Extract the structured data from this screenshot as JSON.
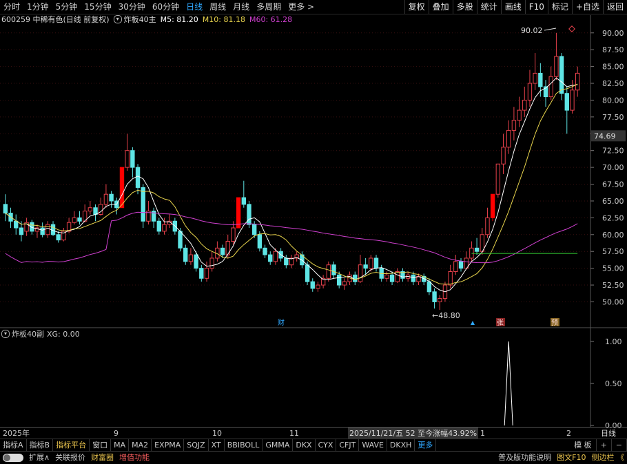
{
  "toolbar": {
    "timeframes": [
      "分时",
      "1分钟",
      "5分钟",
      "15分钟",
      "30分钟",
      "60分钟",
      "日线",
      "周线",
      "月线",
      "多周期",
      "更多 >"
    ],
    "active_index": 6,
    "right_buttons": [
      "复权",
      "叠加",
      "多股",
      "统计",
      "画线",
      "F10",
      "标记",
      "+自选",
      "返回"
    ]
  },
  "info": {
    "stock": "600259 中稀有色(日线 前复权)",
    "indicator": "炸板40主",
    "m5": "M5: 81.20",
    "m10": "M10: 81.18",
    "m60": "M60: 61.28",
    "colors": {
      "m5": "#ffffff",
      "m10": "#e8d44d",
      "m60": "#d040d0",
      "up": "#e8414b",
      "down": "#5ee5e5",
      "limit": "#ff0000"
    }
  },
  "price_axis": [
    "90.00",
    "87.50",
    "85.00",
    "82.50",
    "80.00",
    "77.50",
    "75.00",
    "72.50",
    "70.00",
    "67.50",
    "65.00",
    "62.50",
    "60.00",
    "57.50",
    "55.00",
    "52.50",
    "50.00"
  ],
  "current_price": "74.69",
  "annotations": {
    "high": "90.02",
    "low": "48.80",
    "marks": [
      "财",
      "张",
      "预"
    ]
  },
  "sub": {
    "title": "炸板40副",
    "xg": "XG: 0.00",
    "axis": [
      "1.00",
      "0.50",
      "0.00"
    ]
  },
  "datebar": {
    "year": "2025年",
    "months": [
      "9",
      "10",
      "11",
      "1",
      "2"
    ],
    "cursor_info": "2025/11/21/五 52 至今涨幅43.92%",
    "period": "日线"
  },
  "indicators": [
    "指标A",
    "指标B",
    "指标平台",
    "窗口",
    "MA",
    "MA2",
    "EXPMA",
    "SQJZ",
    "XT",
    "BBIBOLL",
    "GMMA",
    "DKX",
    "CYX",
    "CFJT",
    "WAVE",
    "DKXH",
    "更多"
  ],
  "indicator_right": [
    "模 板",
    "+",
    "−"
  ],
  "bottom": {
    "left": [
      "扩展∧",
      "关联报价",
      "财富圈",
      "增值功能"
    ],
    "right": [
      "普及版功能说明",
      "图文F10",
      "侧边栏 《"
    ]
  },
  "chart_data": {
    "type": "candlestick",
    "ylim": [
      48.0,
      91.0
    ],
    "candles": [
      [
        64.5,
        63.2,
        66.0,
        62.0
      ],
      [
        63.2,
        62.0,
        64.0,
        61.0
      ],
      [
        62.0,
        61.0,
        63.0,
        60.0
      ],
      [
        61.0,
        60.0,
        62.0,
        59.0
      ],
      [
        60.5,
        61.8,
        62.5,
        59.8
      ],
      [
        61.8,
        60.5,
        62.2,
        60.0
      ],
      [
        60.5,
        61.0,
        61.5,
        59.5
      ],
      [
        61.0,
        60.0,
        61.8,
        59.6
      ],
      [
        60.0,
        61.5,
        62.0,
        59.5
      ],
      [
        61.5,
        60.0,
        62.0,
        59.8
      ],
      [
        60.0,
        59.2,
        60.5,
        58.8
      ],
      [
        59.2,
        60.5,
        61.0,
        59.0
      ],
      [
        60.5,
        61.8,
        62.5,
        60.2
      ],
      [
        61.8,
        62.5,
        63.5,
        61.5
      ],
      [
        62.5,
        62.0,
        63.5,
        61.5
      ],
      [
        62.0,
        63.5,
        64.5,
        61.8
      ],
      [
        63.5,
        64.0,
        65.0,
        63.0
      ],
      [
        64.0,
        63.0,
        64.5,
        62.0
      ],
      [
        63.0,
        64.5,
        65.5,
        62.8
      ],
      [
        64.5,
        66.0,
        67.5,
        64.0
      ],
      [
        66.0,
        65.0,
        66.5,
        64.0
      ],
      [
        65.0,
        64.0,
        65.5,
        63.0
      ],
      [
        64.0,
        70.0,
        70.0,
        64.0
      ],
      [
        70.0,
        72.5,
        75.0,
        69.5
      ],
      [
        72.5,
        70.0,
        73.0,
        68.5
      ],
      [
        70.0,
        67.0,
        70.5,
        66.0
      ],
      [
        67.0,
        62.0,
        67.5,
        61.0
      ],
      [
        62.0,
        63.5,
        65.0,
        61.5
      ],
      [
        63.5,
        62.0,
        64.0,
        61.0
      ],
      [
        62.0,
        60.5,
        62.5,
        60.0
      ],
      [
        60.5,
        61.5,
        62.5,
        60.0
      ],
      [
        61.5,
        62.0,
        63.0,
        61.0
      ],
      [
        62.0,
        60.5,
        62.5,
        60.0
      ],
      [
        60.5,
        58.0,
        61.0,
        57.5
      ],
      [
        58.0,
        56.0,
        58.5,
        55.5
      ],
      [
        56.0,
        57.0,
        58.0,
        55.5
      ],
      [
        57.0,
        55.0,
        57.5,
        54.5
      ],
      [
        55.0,
        53.5,
        55.5,
        53.0
      ],
      [
        53.5,
        55.0,
        56.0,
        53.0
      ],
      [
        55.0,
        56.5,
        57.5,
        54.5
      ],
      [
        56.5,
        58.0,
        59.0,
        56.0
      ],
      [
        58.0,
        57.0,
        58.5,
        56.5
      ],
      [
        57.0,
        59.0,
        60.0,
        56.5
      ],
      [
        59.0,
        61.0,
        62.0,
        58.5
      ],
      [
        61.0,
        65.5,
        65.5,
        61.0
      ],
      [
        65.5,
        64.5,
        68.0,
        64.0
      ],
      [
        64.5,
        61.5,
        65.0,
        61.0
      ],
      [
        61.5,
        60.0,
        62.0,
        59.5
      ],
      [
        60.0,
        58.0,
        60.5,
        57.5
      ],
      [
        58.0,
        57.0,
        58.5,
        56.5
      ],
      [
        57.0,
        56.0,
        57.5,
        55.5
      ],
      [
        56.0,
        57.5,
        58.0,
        55.5
      ],
      [
        57.5,
        56.5,
        58.0,
        56.0
      ],
      [
        56.5,
        55.5,
        57.0,
        55.0
      ],
      [
        55.5,
        56.5,
        57.0,
        55.0
      ],
      [
        56.5,
        57.0,
        57.5,
        56.0
      ],
      [
        57.0,
        55.5,
        57.5,
        55.0
      ],
      [
        55.5,
        53.0,
        56.0,
        52.5
      ],
      [
        53.0,
        52.0,
        53.5,
        51.5
      ],
      [
        52.0,
        52.5,
        53.0,
        51.5
      ],
      [
        52.5,
        53.5,
        54.0,
        52.0
      ],
      [
        53.5,
        55.5,
        56.0,
        53.0
      ],
      [
        55.5,
        54.0,
        56.0,
        53.5
      ],
      [
        54.0,
        52.5,
        54.5,
        52.0
      ],
      [
        52.5,
        53.0,
        53.5,
        51.8
      ],
      [
        53.0,
        54.0,
        54.5,
        52.5
      ],
      [
        54.0,
        53.0,
        54.5,
        52.5
      ],
      [
        53.0,
        55.5,
        57.0,
        52.8
      ],
      [
        55.5,
        55.0,
        56.5,
        54.0
      ],
      [
        55.0,
        56.5,
        57.0,
        54.5
      ],
      [
        56.5,
        55.0,
        57.0,
        54.5
      ],
      [
        55.0,
        53.5,
        55.5,
        53.0
      ],
      [
        53.5,
        54.0,
        54.5,
        53.0
      ],
      [
        54.0,
        53.0,
        54.5,
        52.5
      ],
      [
        53.0,
        54.5,
        55.0,
        52.8
      ],
      [
        54.5,
        53.5,
        55.0,
        53.0
      ],
      [
        53.5,
        54.0,
        54.5,
        53.0
      ],
      [
        54.0,
        53.0,
        54.5,
        52.5
      ],
      [
        53.0,
        53.8,
        54.2,
        52.5
      ],
      [
        53.8,
        53.0,
        54.2,
        52.5
      ],
      [
        53.0,
        51.5,
        53.5,
        51.0
      ],
      [
        51.5,
        50.0,
        52.0,
        49.0
      ],
      [
        50.0,
        50.5,
        51.0,
        48.8
      ],
      [
        50.5,
        52.5,
        53.0,
        50.0
      ],
      [
        52.5,
        54.5,
        55.5,
        52.0
      ],
      [
        54.5,
        56.0,
        57.0,
        54.0
      ],
      [
        56.0,
        55.0,
        56.5,
        54.5
      ],
      [
        55.0,
        56.5,
        57.5,
        54.8
      ],
      [
        56.5,
        58.0,
        59.0,
        56.0
      ],
      [
        58.0,
        57.5,
        59.5,
        57.0
      ],
      [
        57.5,
        60.0,
        61.0,
        57.0
      ],
      [
        60.0,
        62.5,
        64.0,
        59.5
      ],
      [
        62.5,
        66.0,
        66.0,
        62.0
      ],
      [
        66.0,
        70.5,
        70.5,
        65.5
      ],
      [
        70.5,
        73.0,
        75.0,
        69.0
      ],
      [
        73.0,
        75.5,
        77.0,
        72.0
      ],
      [
        75.5,
        77.0,
        79.0,
        74.0
      ],
      [
        77.0,
        78.5,
        80.5,
        76.0
      ],
      [
        78.5,
        80.0,
        82.0,
        77.5
      ],
      [
        80.0,
        82.5,
        84.5,
        79.0
      ],
      [
        82.5,
        84.0,
        87.0,
        81.5
      ],
      [
        84.0,
        82.0,
        85.5,
        80.5
      ],
      [
        82.0,
        80.5,
        83.0,
        79.0
      ],
      [
        80.5,
        83.5,
        85.0,
        80.0
      ],
      [
        83.5,
        86.5,
        90.0,
        83.0
      ],
      [
        86.5,
        81.0,
        87.0,
        80.0
      ],
      [
        81.0,
        78.5,
        82.0,
        75.0
      ],
      [
        78.5,
        81.5,
        83.0,
        78.0
      ],
      [
        81.5,
        84.0,
        85.0,
        80.5
      ]
    ],
    "ma_m5_last": 81.2,
    "ma_m10_last": 81.18,
    "ma_m60_last": 61.28,
    "sub_signal": {
      "index": 95,
      "value": 1.0
    }
  }
}
